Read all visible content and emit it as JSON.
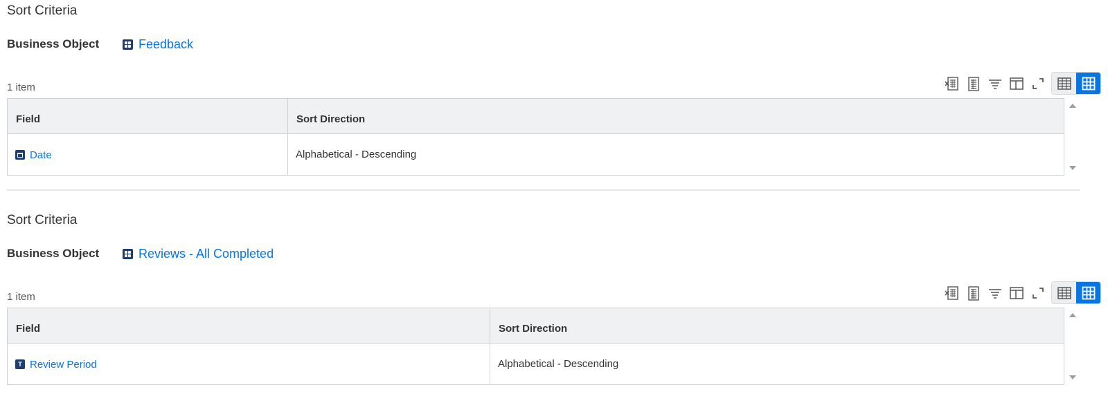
{
  "sections": [
    {
      "title": "Sort Criteria",
      "business_object_label": "Business Object",
      "business_object_value": "Feedback",
      "item_count": "1 item",
      "columns": [
        "Field",
        "Sort Direction"
      ],
      "rows": [
        {
          "field": "Date",
          "field_icon": "calendar-icon",
          "sort_direction": "Alphabetical - Descending"
        }
      ]
    },
    {
      "title": "Sort Criteria",
      "business_object_label": "Business Object",
      "business_object_value": "Reviews - All Completed",
      "item_count": "1 item",
      "columns": [
        "Field",
        "Sort Direction"
      ],
      "rows": [
        {
          "field": "Review Period",
          "field_icon": "text-field-icon",
          "field_icon_glyph": "T",
          "sort_direction": "Alphabetical - Descending"
        }
      ]
    }
  ],
  "toolbar_icons": [
    "export-excel-icon",
    "export-pdf-icon",
    "filter-icon",
    "column-config-icon",
    "fullscreen-icon",
    "table-view-icon",
    "grid-view-icon"
  ],
  "colors": {
    "link": "#0875e1",
    "icon_bg": "#1f3d6e",
    "active_toggle": "#0875e1",
    "header_bg": "#f0f1f3"
  }
}
